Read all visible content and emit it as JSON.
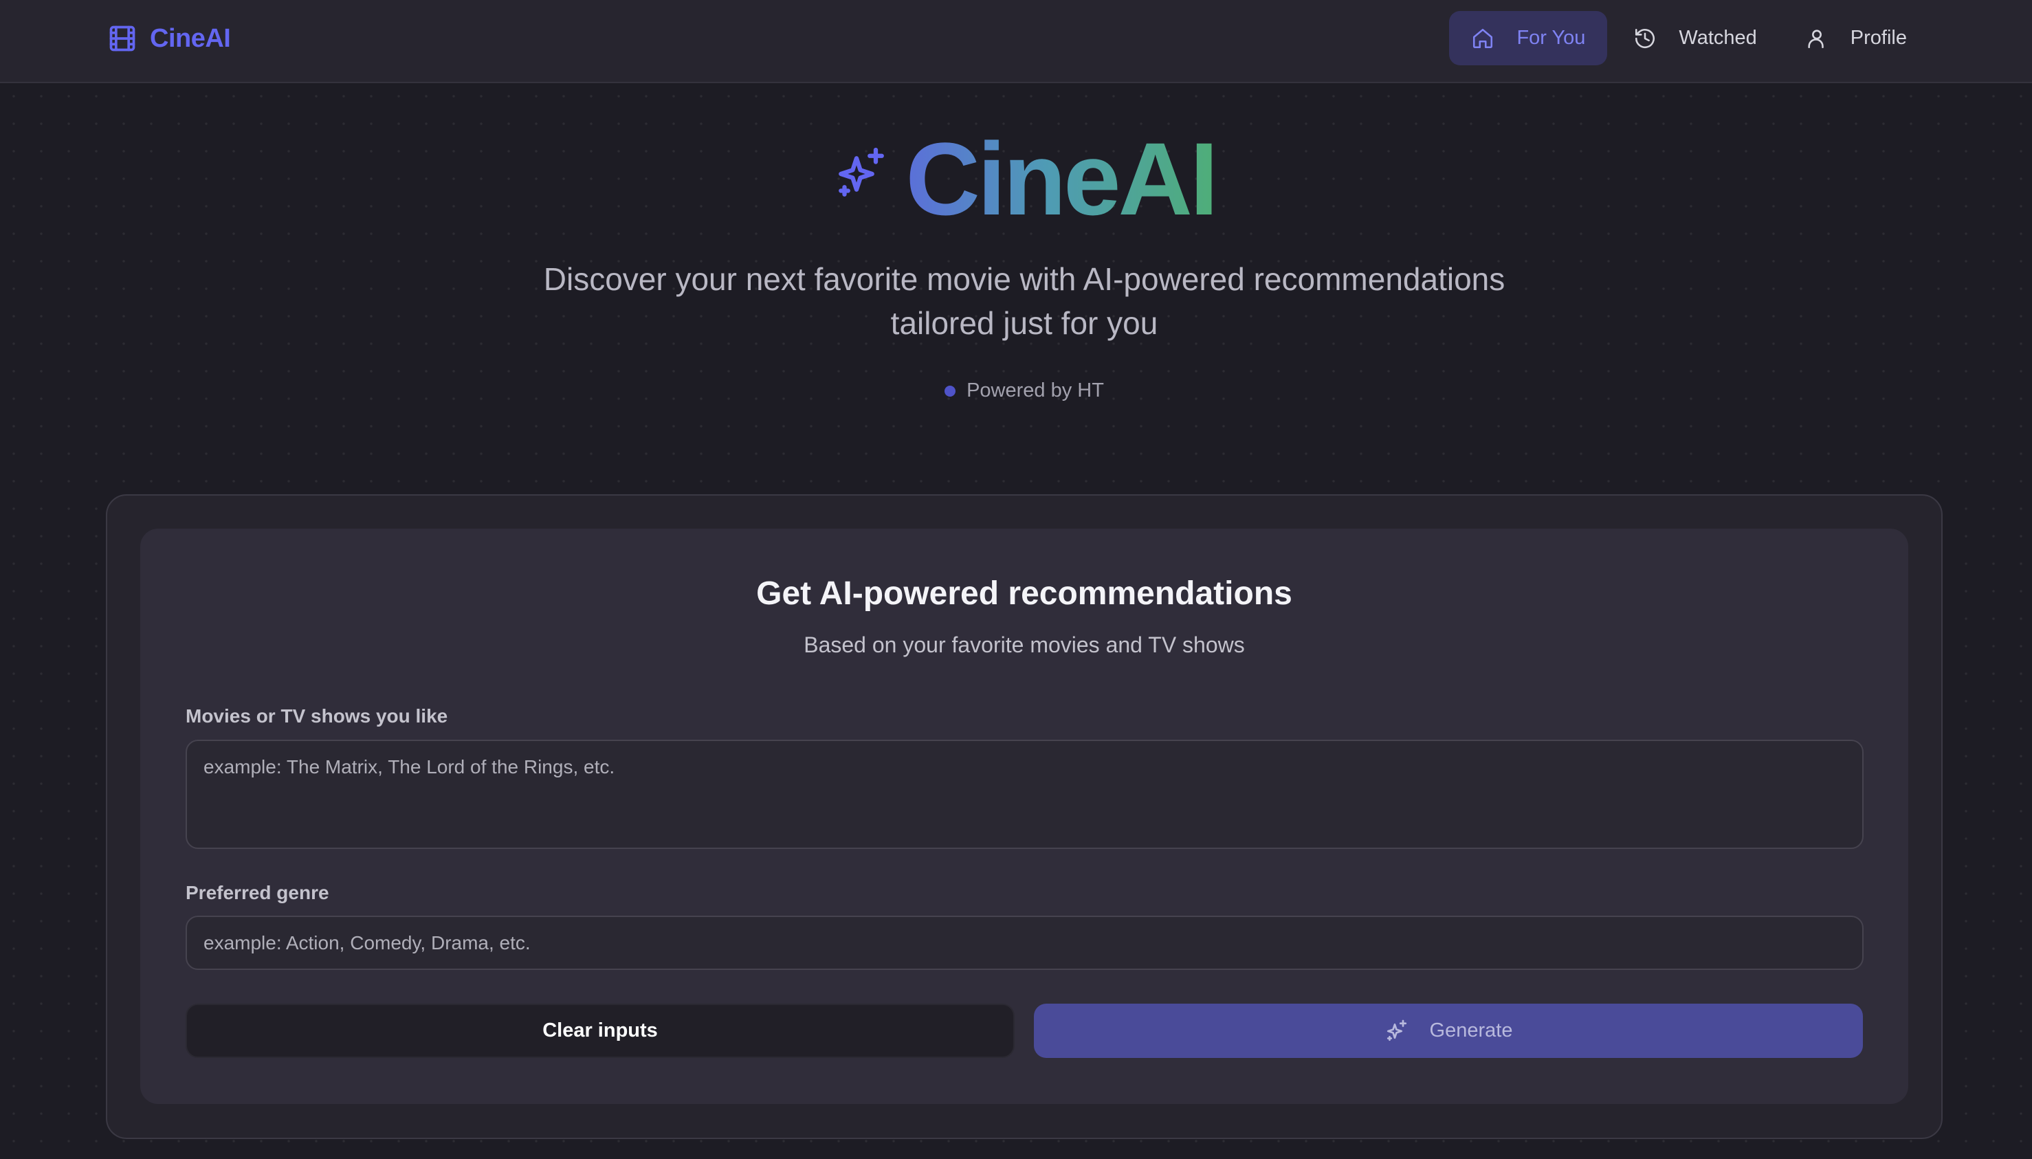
{
  "brand": {
    "name": "CineAI",
    "icon": "film-icon"
  },
  "nav": {
    "items": [
      {
        "label": "For You",
        "icon": "home-icon",
        "active": true
      },
      {
        "label": "Watched",
        "icon": "history-icon",
        "active": false
      },
      {
        "label": "Profile",
        "icon": "user-icon",
        "active": false
      }
    ]
  },
  "hero": {
    "title": "CineAI",
    "icon": "sparkles-icon",
    "subtitle_line1": "Discover your next favorite movie with AI-powered recommendations",
    "subtitle_line2": "tailored just for you",
    "powered_by": "Powered by HT"
  },
  "form": {
    "title": "Get AI-powered recommendations",
    "subtitle": "Based on your favorite movies and TV shows",
    "movies_label": "Movies or TV shows you like",
    "movies_placeholder": "example: The Matrix, The Lord of the Rings, etc.",
    "genre_label": "Preferred genre",
    "genre_placeholder": "example: Action, Comedy, Drama, etc.",
    "clear_label": "Clear inputs",
    "generate_label": "Generate"
  },
  "colors": {
    "accent": "#6366f1",
    "active_nav_bg": "#34325c",
    "generate_bg": "#4a4b99",
    "background": "#1d1c24",
    "title_gradient": [
      "#5b6fd9",
      "#4f9bb5",
      "#4fae78"
    ]
  }
}
